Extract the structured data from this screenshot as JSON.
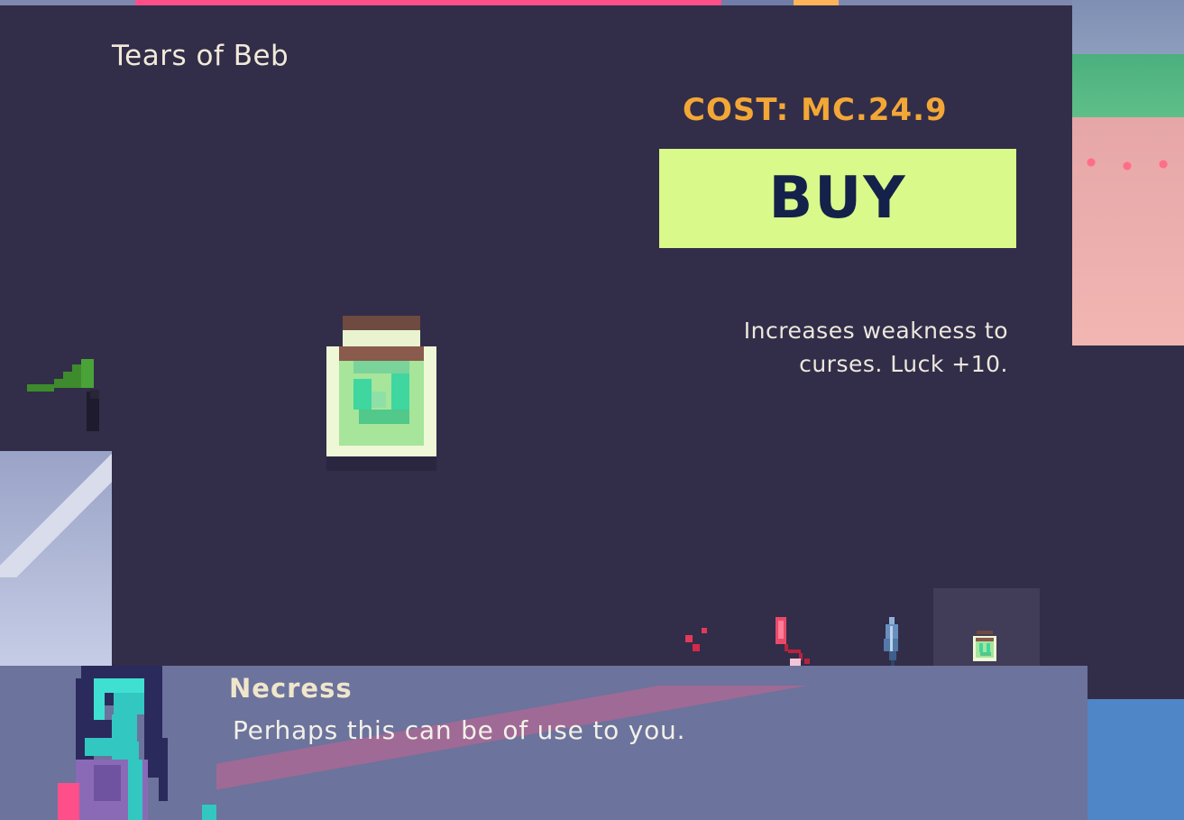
{
  "item": {
    "name": "Tears of Beb",
    "cost": "COST: MC.24.9",
    "description": "Increases weakness to curses. Luck +10."
  },
  "buy_label": "BUY",
  "inventory": {
    "items": [
      "red-berries-icon",
      "red-lantern-icon",
      "blue-feather-icon",
      "green-jar-icon"
    ],
    "selected_index": 3
  },
  "dialogue": {
    "speaker": "Necress",
    "text": "Perhaps this can be of use to you."
  },
  "colors": {
    "panel": "#322d49",
    "cost": "#f2a736",
    "buy_button": "#d9f98a",
    "buy_text": "#14214a",
    "dialogue_box": "#6c739c"
  }
}
